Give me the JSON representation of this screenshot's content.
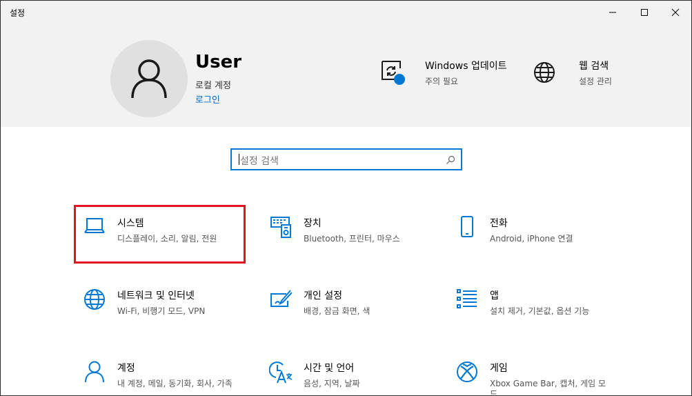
{
  "window": {
    "title": "설정"
  },
  "user": {
    "name": "User",
    "account_type": "로컬 계정",
    "login_link": "로그인"
  },
  "header_items": [
    {
      "title": "Windows 업데이트",
      "subtitle": "주의 필요",
      "icon": "windows-update-icon"
    },
    {
      "title": "웹 검색",
      "subtitle": "설정 관리",
      "icon": "globe-icon"
    }
  ],
  "search": {
    "placeholder": "설정 검색"
  },
  "tiles": [
    {
      "title": "시스템",
      "subtitle": "디스플레이, 소리, 알림, 전원",
      "icon": "laptop-icon"
    },
    {
      "title": "장치",
      "subtitle": "Bluetooth, 프린터, 마우스",
      "icon": "devices-icon"
    },
    {
      "title": "전화",
      "subtitle": "Android, iPhone 연결",
      "icon": "phone-icon"
    },
    {
      "title": "네트워크 및 인터넷",
      "subtitle": "Wi-Fi, 비행기 모드, VPN",
      "icon": "globe-icon"
    },
    {
      "title": "개인 설정",
      "subtitle": "배경, 잠금 화면, 색",
      "icon": "personalization-icon"
    },
    {
      "title": "앱",
      "subtitle": "설치 제거, 기본값, 옵션 기능",
      "icon": "apps-list-icon"
    },
    {
      "title": "계정",
      "subtitle": "내 계정, 메일, 동기화, 회사, 가족",
      "icon": "person-icon"
    },
    {
      "title": "시간 및 언어",
      "subtitle": "음성, 지역, 날짜",
      "icon": "time-language-icon"
    },
    {
      "title": "게임",
      "subtitle": "Xbox Game Bar, 캡처, 게임 모드",
      "icon": "xbox-icon"
    }
  ],
  "colors": {
    "accent": "#0078d4",
    "link": "#0067c0",
    "highlight": "#e81123",
    "hero_bg": "#f2f2f2"
  }
}
